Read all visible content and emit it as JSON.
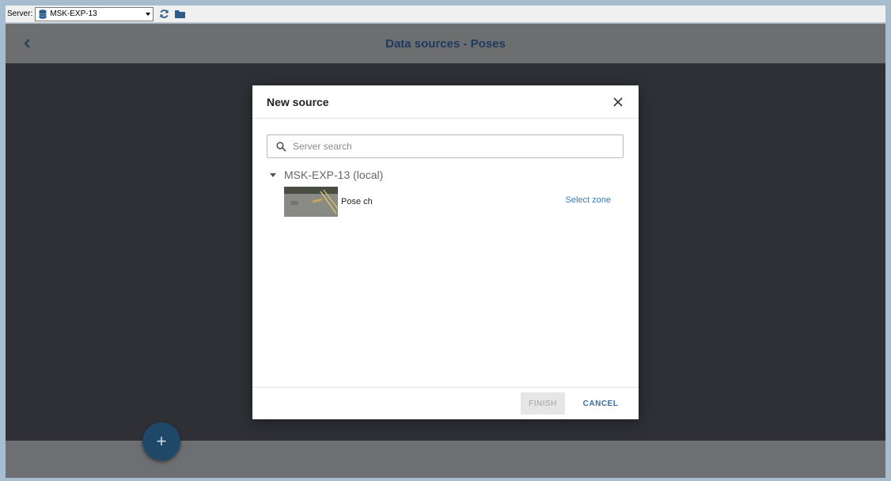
{
  "toolbar": {
    "server_label": "Server:",
    "server_value": "MSK-EXP-13",
    "icons": [
      "database-icon",
      "refresh-icon",
      "folder-icon"
    ]
  },
  "page": {
    "title": "Data sources - Poses",
    "back_icon": "chevron-left-icon",
    "fab_label": "+"
  },
  "dialog": {
    "title": "New source",
    "search": {
      "placeholder": "Server search",
      "value": ""
    },
    "tree": {
      "node_label": "MSK-EXP-13 (local)",
      "items": [
        {
          "name": "Pose ch",
          "action": "Select zone"
        }
      ]
    },
    "footer": {
      "finish_label": "FINISH",
      "cancel_label": "CANCEL"
    }
  },
  "colors": {
    "accent": "#3a79b8",
    "title_color": "#1d3a5e",
    "fab": "#1f4868"
  }
}
